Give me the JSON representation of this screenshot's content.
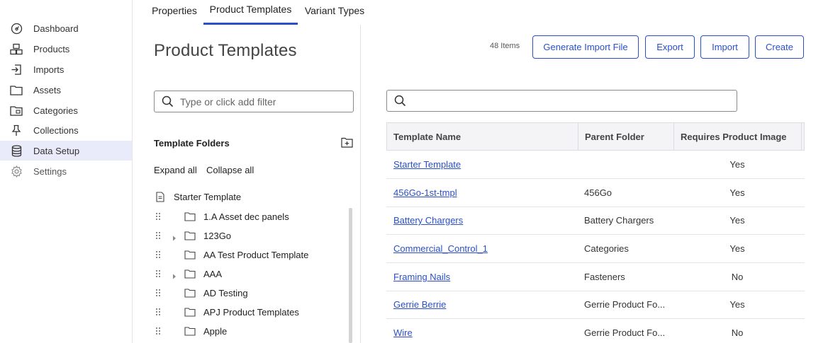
{
  "sidebar": {
    "items": [
      {
        "label": "Dashboard",
        "icon": "dashboard-icon"
      },
      {
        "label": "Products",
        "icon": "products-icon"
      },
      {
        "label": "Imports",
        "icon": "imports-icon"
      },
      {
        "label": "Assets",
        "icon": "folder-icon"
      },
      {
        "label": "Categories",
        "icon": "categories-icon"
      },
      {
        "label": "Collections",
        "icon": "pin-icon"
      },
      {
        "label": "Data Setup",
        "icon": "database-icon",
        "active": true
      },
      {
        "label": "Settings",
        "icon": "gear-icon"
      }
    ]
  },
  "tabs": [
    {
      "label": "Properties"
    },
    {
      "label": "Product Templates",
      "active": true
    },
    {
      "label": "Variant Types"
    }
  ],
  "left_panel": {
    "title": "Product Templates",
    "filter_placeholder": "Type or click add filter",
    "folders_heading": "Template Folders",
    "expand_all": "Expand all",
    "collapse_all": "Collapse all",
    "tree": [
      {
        "label": "Starter Template",
        "type": "template"
      },
      {
        "label": "1.A Asset dec panels",
        "type": "folder"
      },
      {
        "label": "123Go",
        "type": "folder",
        "expandable": true
      },
      {
        "label": "AA Test Product Template",
        "type": "folder"
      },
      {
        "label": "AAA",
        "type": "folder",
        "expandable": true
      },
      {
        "label": "AD Testing",
        "type": "folder"
      },
      {
        "label": "APJ Product Templates",
        "type": "folder"
      },
      {
        "label": "Apple",
        "type": "folder"
      }
    ]
  },
  "toolbar": {
    "items_count": "48 Items",
    "generate_label": "Generate Import File",
    "export_label": "Export",
    "import_label": "Import",
    "create_label": "Create"
  },
  "table": {
    "columns": [
      "Template Name",
      "Parent Folder",
      "Requires Product Image"
    ],
    "rows": [
      {
        "name": "Starter Template",
        "parent": "",
        "requires_image": "Yes"
      },
      {
        "name": "456Go-1st-tmpl",
        "parent": "456Go",
        "requires_image": "Yes"
      },
      {
        "name": "Battery Chargers",
        "parent": "Battery Chargers",
        "requires_image": "Yes"
      },
      {
        "name": "Commercial_Control_1",
        "parent": "Categories",
        "requires_image": "Yes"
      },
      {
        "name": "Framing Nails",
        "parent": "Fasteners",
        "requires_image": "No"
      },
      {
        "name": "Gerrie Berrie",
        "parent": "Gerrie Product Fo...",
        "requires_image": "Yes"
      },
      {
        "name": "Wire",
        "parent": "Gerrie Product Fo...",
        "requires_image": "No"
      }
    ]
  },
  "colors": {
    "accent": "#2a4fc9",
    "active_nav_bg": "#e9ebfb",
    "header_bg": "#f4f4f6"
  }
}
